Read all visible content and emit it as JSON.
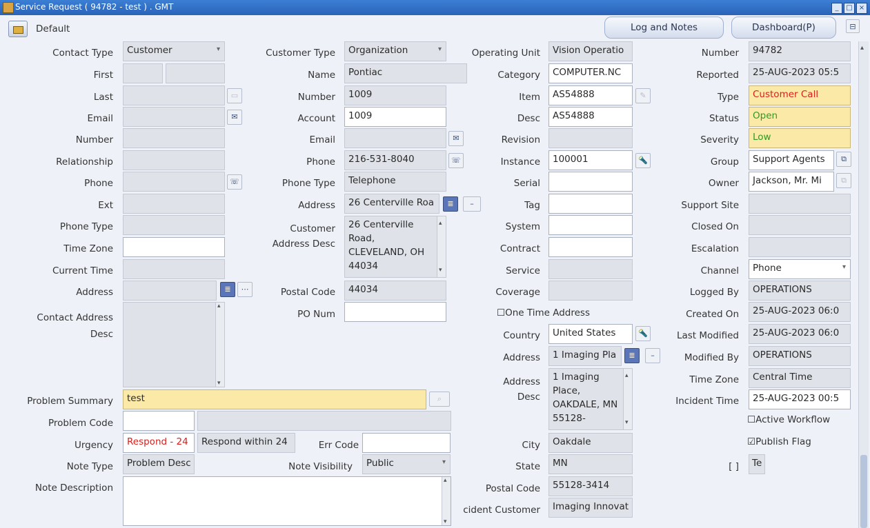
{
  "window": {
    "title": "Service Request ( 94782 - test ) . GMT"
  },
  "toolbar": {
    "folder_label": "Default",
    "log_notes": "Log and Notes",
    "dashboard": "Dashboard(P)"
  },
  "contact": {
    "contact_type_label": "Contact Type",
    "contact_type": "Customer",
    "first_label": "First",
    "last_label": "Last",
    "email_label": "Email",
    "number_label": "Number",
    "relationship_label": "Relationship",
    "phone_label": "Phone",
    "ext_label": "Ext",
    "phone_type_label": "Phone Type",
    "time_zone_label": "Time Zone",
    "current_time_label": "Current Time",
    "address_label": "Address",
    "contact_address_desc_label": "Contact Address Desc"
  },
  "customer": {
    "type_label": "Customer Type",
    "type": "Organization",
    "name_label": "Name",
    "name": "Pontiac",
    "number_label": "Number",
    "number": "1009",
    "account_label": "Account",
    "account": "1009",
    "email_label": "Email",
    "phone_label": "Phone",
    "phone": "216-531-8040",
    "phone_type_label": "Phone Type",
    "phone_type": "Telephone",
    "address_label": "Address",
    "address": "26 Centerville Roa",
    "address_desc_label": "Customer Address Desc",
    "address_desc": "26 Centerville Road, CLEVELAND, OH 44034",
    "postal_code_label": "Postal Code",
    "postal_code": "44034",
    "po_num_label": "PO Num"
  },
  "product": {
    "operating_unit_label": "Operating Unit",
    "operating_unit": "Vision Operatio",
    "category_label": "Category",
    "category": "COMPUTER.NC",
    "item_label": "Item",
    "item": "AS54888",
    "desc_label": "Desc",
    "desc": "AS54888",
    "revision_label": "Revision",
    "instance_label": "Instance",
    "instance": "100001",
    "serial_label": "Serial",
    "tag_label": "Tag",
    "system_label": "System",
    "contract_label": "Contract",
    "service_label": "Service",
    "coverage_label": "Coverage",
    "one_time_address": "One Time Address",
    "country_label": "Country",
    "country": "United States",
    "address_label": "Address",
    "address": "1 Imaging Pla",
    "address_desc_label": "Address Desc",
    "address_desc": "1 Imaging Place, OAKDALE, MN 55128-",
    "city_label": "City",
    "city": "Oakdale",
    "state_label": "State",
    "state": "MN",
    "postal_code_label": "Postal Code",
    "postal_code": "55128-3414",
    "incident_customer_label": "cident Customer",
    "incident_customer": "Imaging Innovat"
  },
  "request": {
    "number_label": "Number",
    "number": "94782",
    "reported_label": "Reported",
    "reported": "25-AUG-2023 05:5",
    "type_label": "Type",
    "type": "Customer Call",
    "status_label": "Status",
    "status": "Open",
    "severity_label": "Severity",
    "severity": "Low",
    "group_label": "Group",
    "group": "Support Agents",
    "owner_label": "Owner",
    "owner": "Jackson, Mr. Mi",
    "support_site_label": "Support Site",
    "closed_on_label": "Closed On",
    "escalation_label": "Escalation",
    "channel_label": "Channel",
    "channel": "Phone",
    "logged_by_label": "Logged By",
    "logged_by": "OPERATIONS",
    "created_on_label": "Created On",
    "created_on": "25-AUG-2023 06:0",
    "last_modified_label": "Last Modified",
    "last_modified": "25-AUG-2023 06:0",
    "modified_by_label": "Modified By",
    "modified_by": "OPERATIONS",
    "time_zone_label": "Time Zone",
    "time_zone": "Central Time",
    "incident_time_label": "Incident Time",
    "incident_time": "25-AUG-2023 00:5",
    "active_workflow": "Active Workflow",
    "publish_flag": "Publish Flag",
    "bracket_label": "[ ]",
    "te": "Te"
  },
  "problem": {
    "summary_label": "Problem Summary",
    "summary": "test",
    "code_label": "Problem Code",
    "urgency_label": "Urgency",
    "urgency": "Respond - 24",
    "urgency_desc": "Respond within 24",
    "err_code_label": "Err Code",
    "note_type_label": "Note Type",
    "note_type": "Problem Desc",
    "note_visibility_label": "Note Visibility",
    "note_visibility": "Public",
    "note_description_label": "Note Description"
  },
  "icons": {
    "flashlight": "flashlight-icon",
    "list": "list-icon",
    "phone": "phone-icon",
    "email": "email-icon"
  },
  "colors": {
    "required": "#fbe9a8",
    "urgency_text": "#d8201c",
    "status_text": "#2e9a22",
    "titlebar": "#2a63b8"
  }
}
